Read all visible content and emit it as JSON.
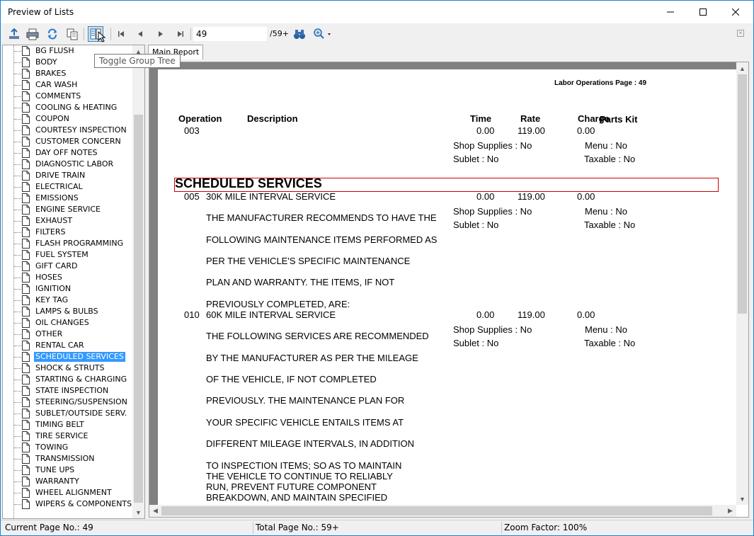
{
  "window": {
    "title": "Preview of Lists"
  },
  "toolbar": {
    "page_number": "49",
    "page_total": "/59+",
    "tooltip": "Toggle Group Tree"
  },
  "tab": {
    "label": "Main Report"
  },
  "tree": {
    "items": [
      "BG FLUSH",
      "BODY",
      "BRAKES",
      "CAR WASH",
      "COMMENTS",
      "COOLING & HEATING",
      "COUPON",
      "COURTESY INSPECTION",
      "CUSTOMER CONCERN",
      "DAY OFF NOTES",
      "DIAGNOSTIC LABOR",
      "DRIVE TRAIN",
      "ELECTRICAL",
      "EMISSIONS",
      "ENGINE SERVICE",
      "EXHAUST",
      "FILTERS",
      "FLASH PROGRAMMING",
      "FUEL SYSTEM",
      "GIFT CARD",
      "HOSES",
      "IGNITION",
      "KEY TAG",
      "LAMPS & BULBS",
      "OIL CHANGES",
      "OTHER",
      "RENTAL CAR",
      "SCHEDULED SERVICES",
      "SHOCK & STRUTS",
      "STARTING & CHARGING",
      "STATE INSPECTION",
      "STEERING/SUSPENSION",
      "SUBLET/OUTSIDE SERV.",
      "TIMING BELT",
      "TIRE SERVICE",
      "TOWING",
      "TRANSMISSION",
      "TUNE UPS",
      "WARRANTY",
      "WHEEL ALIGNMENT",
      "WIPERS & COMPONENTS"
    ],
    "selected": "SCHEDULED SERVICES"
  },
  "report": {
    "page_header": "Labor Operations Page : 49",
    "columns": {
      "operation": "Operation",
      "description": "Description",
      "time": "Time",
      "rate": "Rate",
      "charge": "Charge",
      "parts_kit": "Parts Kit"
    },
    "section_title": "SCHEDULED SERVICES",
    "operations": [
      {
        "code": "003",
        "name": "",
        "time": "0.00",
        "rate": "119.00",
        "charge": "0.00",
        "shop_supplies": "Shop Supplies : No",
        "sublet": "Sublet : No",
        "menu": "Menu : No",
        "taxable": "Taxable : No"
      },
      {
        "code": "005",
        "name": "30K MILE INTERVAL SERVICE",
        "time": "0.00",
        "rate": "119.00",
        "charge": "0.00",
        "shop_supplies": "Shop Supplies : No",
        "sublet": "Sublet : No",
        "menu": "Menu : No",
        "taxable": "Taxable : No",
        "desc_lines": [
          "THE MANUFACTURER RECOMMENDS TO HAVE THE",
          "FOLLOWING MAINTENANCE ITEMS PERFORMED AS",
          "PER THE VEHICLE'S SPECIFIC MAINTENANCE",
          "PLAN AND WARRANTY. THE ITEMS, IF NOT",
          "PREVIOUSLY COMPLETED, ARE:"
        ]
      },
      {
        "code": "010",
        "name": "60K MILE INTERVAL SERVICE",
        "time": "0.00",
        "rate": "119.00",
        "charge": "0.00",
        "shop_supplies": "Shop Supplies : No",
        "sublet": "Sublet : No",
        "menu": "Menu : No",
        "taxable": "Taxable : No",
        "desc_lines": [
          "THE FOLLOWING SERVICES ARE RECOMMENDED",
          "BY THE MANUFACTURER AS PER THE MILEAGE",
          "OF THE VEHICLE, IF NOT COMPLETED",
          "PREVIOUSLY. THE MAINTENANCE PLAN FOR",
          "YOUR SPECIFIC VEHICLE ENTAILS ITEMS AT",
          "DIFFERENT MILEAGE INTERVALS, IN ADDITION",
          "TO INSPECTION ITEMS; SO AS TO MAINTAIN",
          "THE VEHICLE TO CONTINUE TO RELIABLY",
          "RUN, PREVENT FUTURE COMPONENT",
          "BREAKDOWN, AND MAINTAIN SPECIFIED"
        ]
      }
    ]
  },
  "status": {
    "current_page": "Current Page No.: 49",
    "total_page": "Total Page No.: 59+",
    "zoom": "Zoom Factor: 100%"
  },
  "icons": {
    "export": "export-icon",
    "print": "print-icon",
    "refresh": "refresh-icon",
    "copy": "copy-icon",
    "group_tree": "group-tree-icon",
    "first": "first-page-icon",
    "prev": "prev-page-icon",
    "next": "next-page-icon",
    "last": "last-page-icon",
    "search": "binoculars-icon",
    "zoom": "zoom-icon"
  },
  "colors": {
    "selection": "#3399ff",
    "section_border": "#cc0000",
    "window_border": "#1883d7"
  }
}
